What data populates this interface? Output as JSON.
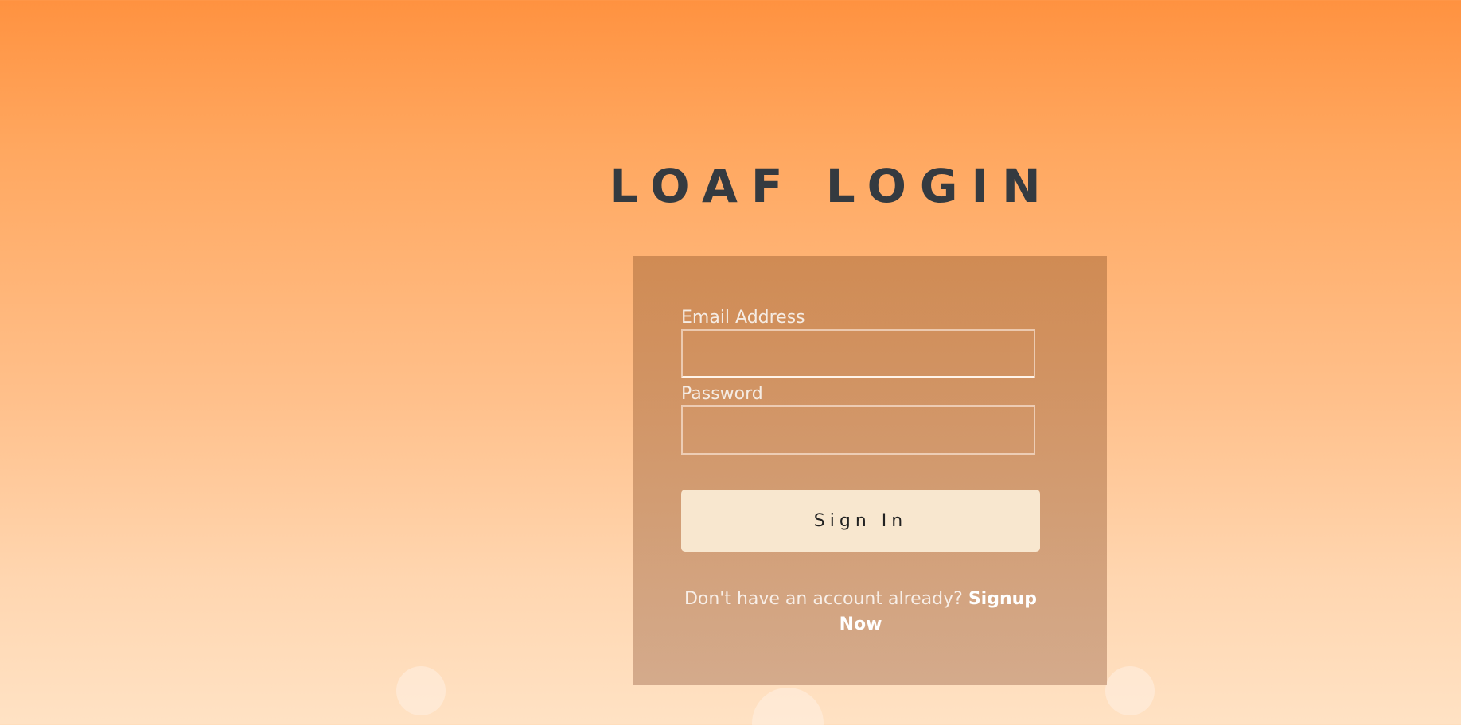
{
  "page": {
    "title": "LOAF LOGIN"
  },
  "form": {
    "email_label": "Email Address",
    "email_value": "",
    "password_label": "Password",
    "password_value": "",
    "signin_label": "Sign In",
    "signup_prompt": "Don't have an account already?",
    "signup_link": "Signup Now"
  },
  "colors": {
    "title": "#343a40",
    "button_bg": "#f8e7cf",
    "background_top": "#ff9240",
    "background_bottom": "#ffe2c4"
  }
}
